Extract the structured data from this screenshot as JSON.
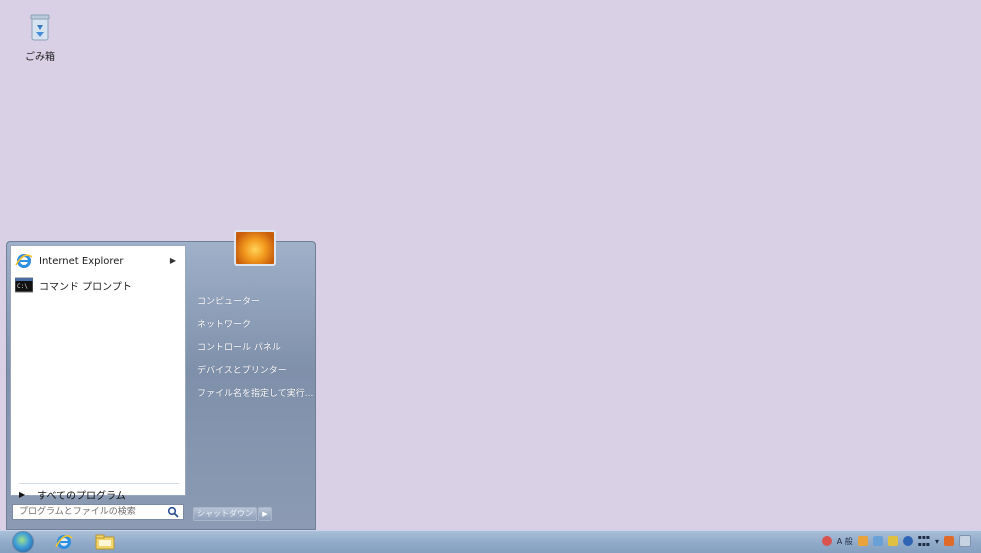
{
  "desktop": {
    "recycle_bin_label": "ごみ箱"
  },
  "start_menu": {
    "pinned": [
      {
        "label": "Internet Explorer",
        "icon": "internet-explorer-icon",
        "has_submenu": true
      },
      {
        "label": "コマンド プロンプト",
        "icon": "command-prompt-icon",
        "has_submenu": false
      }
    ],
    "all_programs_label": "すべてのプログラム",
    "search_placeholder": "プログラムとファイルの検索",
    "right_items": [
      "コンピューター",
      "ネットワーク",
      "コントロール パネル",
      "デバイスとプリンター",
      "ファイル名を指定して実行..."
    ],
    "shutdown_label": "シャットダウン"
  },
  "taskbar": {
    "pinned_icons": [
      "start-orb-icon",
      "internet-explorer-icon",
      "folder-icon"
    ],
    "tray_text": "A 般"
  },
  "colors": {
    "desktop_bg": "#d9d0e6",
    "menu_bg": "#8c9bb3",
    "taskbar_bg": "#8ea8c8"
  }
}
